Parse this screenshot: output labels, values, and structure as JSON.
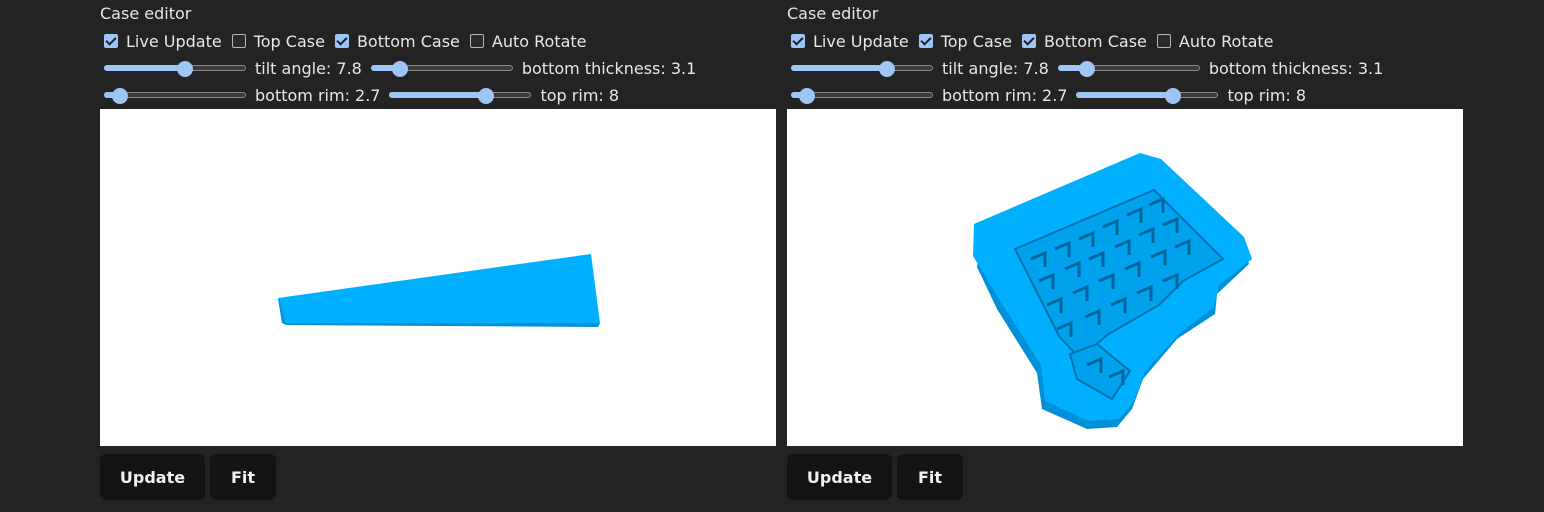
{
  "colors": {
    "background": "#232323",
    "accent": "#9ec5f5",
    "model": "#00b0ff",
    "viewport_bg": "#ffffff"
  },
  "panels": [
    {
      "title": "Case editor",
      "checkboxes": [
        {
          "label": "Live Update",
          "checked": true
        },
        {
          "label": "Top Case",
          "checked": false
        },
        {
          "label": "Bottom Case",
          "checked": true
        },
        {
          "label": "Auto Rotate",
          "checked": false
        }
      ],
      "sliders": [
        {
          "label": "tilt angle: 7.8",
          "value": 0.58
        },
        {
          "label": "bottom thickness: 3.1",
          "value": 0.17
        },
        {
          "label": "bottom rim: 2.7",
          "value": 0.06
        },
        {
          "label": "top rim: 8",
          "value": 0.71
        }
      ],
      "buttons": {
        "update": "Update",
        "fit": "Fit"
      }
    },
    {
      "title": "Case editor",
      "checkboxes": [
        {
          "label": "Live Update",
          "checked": true
        },
        {
          "label": "Top Case",
          "checked": true
        },
        {
          "label": "Bottom Case",
          "checked": true
        },
        {
          "label": "Auto Rotate",
          "checked": false
        }
      ],
      "sliders": [
        {
          "label": "tilt angle: 7.8",
          "value": 0.7
        },
        {
          "label": "bottom thickness: 3.1",
          "value": 0.17
        },
        {
          "label": "bottom rim: 2.7",
          "value": 0.06
        },
        {
          "label": "top rim: 8",
          "value": 0.71
        }
      ],
      "buttons": {
        "update": "Update",
        "fit": "Fit"
      }
    }
  ]
}
